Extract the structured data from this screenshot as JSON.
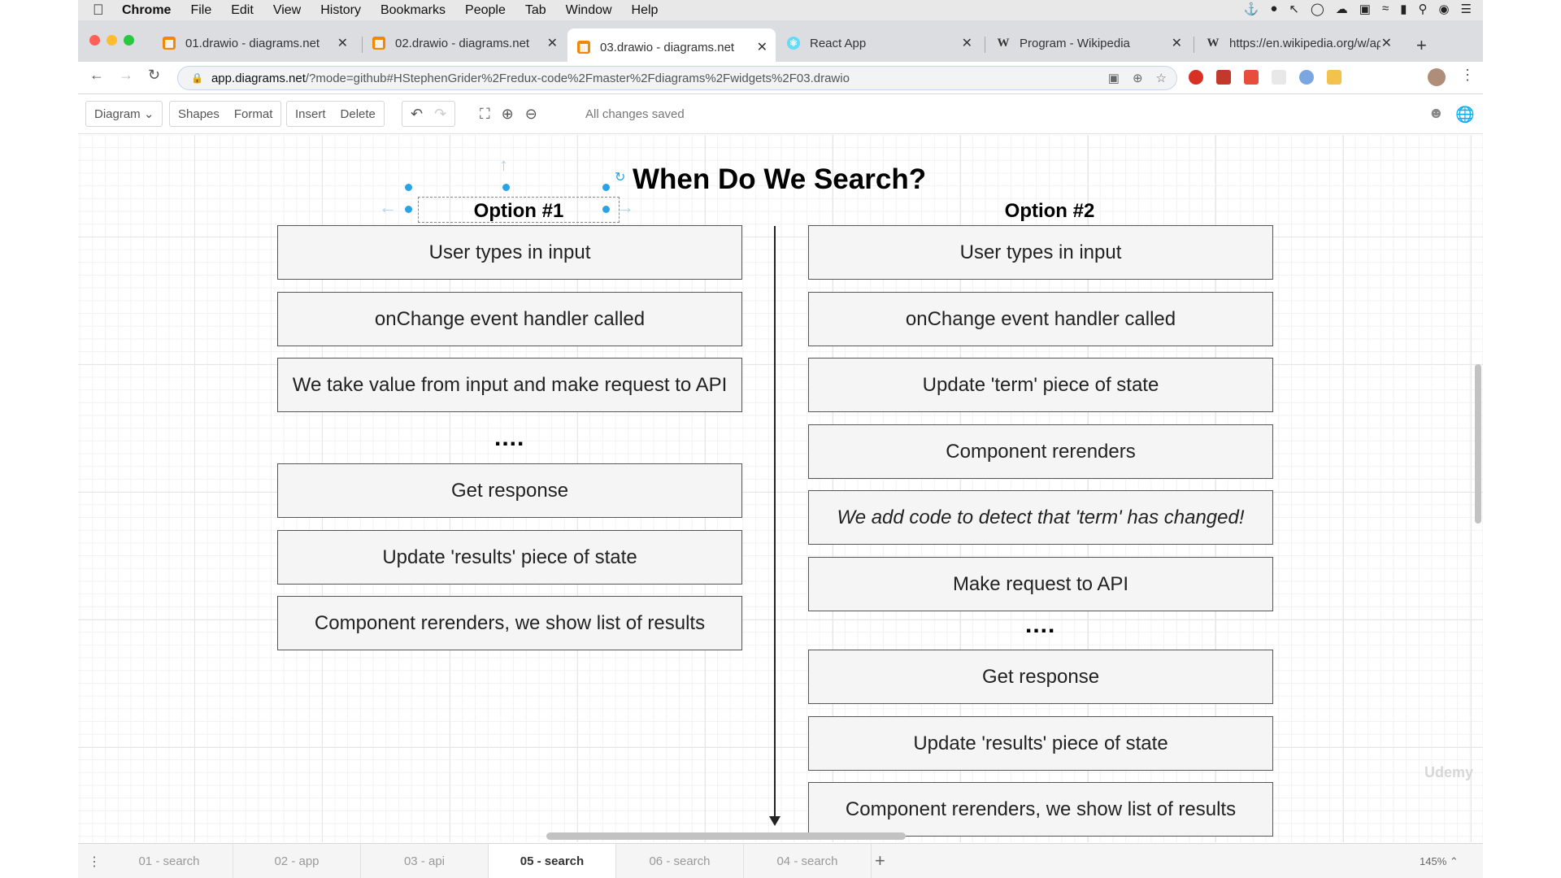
{
  "menubar": {
    "app": "Chrome",
    "items": [
      "File",
      "Edit",
      "View",
      "History",
      "Bookmarks",
      "People",
      "Tab",
      "Window",
      "Help"
    ]
  },
  "tabs": [
    {
      "title": "01.drawio - diagrams.net",
      "icon": "drawio-icon",
      "color": "#f08705"
    },
    {
      "title": "02.drawio - diagrams.net",
      "icon": "drawio-icon",
      "color": "#f08705"
    },
    {
      "title": "03.drawio - diagrams.net",
      "icon": "drawio-icon",
      "color": "#f08705"
    },
    {
      "title": "React App",
      "icon": "react-icon",
      "color": "#61dafb"
    },
    {
      "title": "Program - Wikipedia",
      "icon": "wikipedia-icon",
      "color": "#333333"
    },
    {
      "title": "https://en.wikipedia.org/w/aρ",
      "icon": "wikipedia-icon",
      "color": "#333333"
    }
  ],
  "address": {
    "domain": "app.diagrams.net",
    "path": "/?mode=github#HStephenGrider%2Fredux-code%2Fmaster%2Fdiagrams%2Fwidgets%2F03.drawio"
  },
  "toolbar": {
    "diagram": "Diagram",
    "shapes": "Shapes",
    "format": "Format",
    "insert": "Insert",
    "delete": "Delete",
    "status": "All changes saved"
  },
  "diagram": {
    "title": "When Do We Search?",
    "option1": {
      "heading": "Option #1",
      "steps_a": [
        "User types in input",
        "onChange event handler called",
        "We take value from input and make request to API"
      ],
      "ellipsis": "....",
      "steps_b": [
        "Get response",
        "Update 'results' piece of state",
        "Component rerenders, we show list of results"
      ]
    },
    "option2": {
      "heading": "Option #2",
      "steps_a": [
        "User types in input",
        "onChange event handler called",
        "Update 'term' piece of state",
        "Component rerenders",
        "We add code to detect that 'term' has changed!",
        "Make request to API"
      ],
      "ellipsis": "....",
      "steps_b": [
        "Get response",
        "Update 'results' piece of state",
        "Component rerenders, we show list of results"
      ]
    },
    "watermark": "Udemy"
  },
  "pages": [
    "01 - search",
    "02 - app",
    "03 - api",
    "05 - search",
    "06 - search",
    "04 - search"
  ],
  "active_page": "05 - search",
  "zoom": "145%"
}
